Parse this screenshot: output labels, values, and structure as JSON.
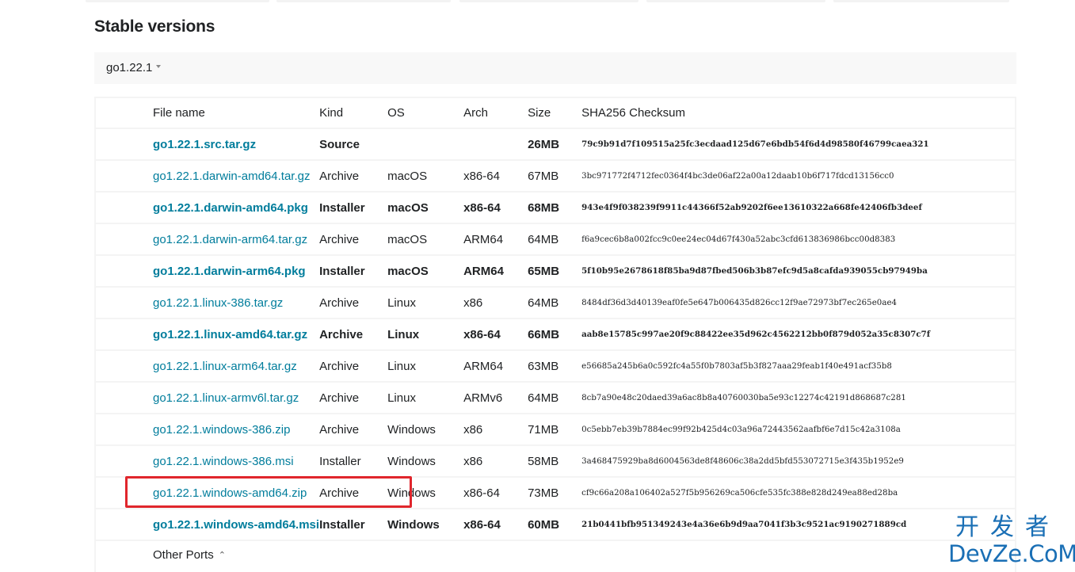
{
  "section": {
    "title": "Stable versions",
    "version_selected": "go1.22.1"
  },
  "table": {
    "headers": [
      "File name",
      "Kind",
      "OS",
      "Arch",
      "Size",
      "SHA256 Checksum"
    ],
    "rows": [
      {
        "name": "go1.22.1.src.tar.gz",
        "kind": "Source",
        "os": "",
        "arch": "",
        "size": "26MB",
        "sha256": "79c9b91d7f109515a25fc3ecdaad125d67e6bdb54f6d4d98580f46799caea321",
        "featured": true
      },
      {
        "name": "go1.22.1.darwin-amd64.tar.gz",
        "kind": "Archive",
        "os": "macOS",
        "arch": "x86-64",
        "size": "67MB",
        "sha256": "3bc971772f4712fec0364f4bc3de06af22a00a12daab10b6f717fdcd13156cc0",
        "featured": false
      },
      {
        "name": "go1.22.1.darwin-amd64.pkg",
        "kind": "Installer",
        "os": "macOS",
        "arch": "x86-64",
        "size": "68MB",
        "sha256": "943e4f9f038239f9911c44366f52ab9202f6ee13610322a668fe42406fb3deef",
        "featured": true
      },
      {
        "name": "go1.22.1.darwin-arm64.tar.gz",
        "kind": "Archive",
        "os": "macOS",
        "arch": "ARM64",
        "size": "64MB",
        "sha256": "f6a9cec6b8a002fcc9c0ee24ec04d67f430a52abc3cfd613836986bcc00d8383",
        "featured": false
      },
      {
        "name": "go1.22.1.darwin-arm64.pkg",
        "kind": "Installer",
        "os": "macOS",
        "arch": "ARM64",
        "size": "65MB",
        "sha256": "5f10b95e2678618f85ba9d87fbed506b3b87efc9d5a8cafda939055cb97949ba",
        "featured": true
      },
      {
        "name": "go1.22.1.linux-386.tar.gz",
        "kind": "Archive",
        "os": "Linux",
        "arch": "x86",
        "size": "64MB",
        "sha256": "8484df36d3d40139eaf0fe5e647b006435d826cc12f9ae72973bf7ec265e0ae4",
        "featured": false
      },
      {
        "name": "go1.22.1.linux-amd64.tar.gz",
        "kind": "Archive",
        "os": "Linux",
        "arch": "x86-64",
        "size": "66MB",
        "sha256": "aab8e15785c997ae20f9c88422ee35d962c4562212bb0f879d052a35c8307c7f",
        "featured": true
      },
      {
        "name": "go1.22.1.linux-arm64.tar.gz",
        "kind": "Archive",
        "os": "Linux",
        "arch": "ARM64",
        "size": "63MB",
        "sha256": "e56685a245b6a0c592fc4a55f0b7803af5b3f827aaa29feab1f40e491acf35b8",
        "featured": false
      },
      {
        "name": "go1.22.1.linux-armv6l.tar.gz",
        "kind": "Archive",
        "os": "Linux",
        "arch": "ARMv6",
        "size": "64MB",
        "sha256": "8cb7a90e48c20daed39a6ac8b8a40760030ba5e93c12274c42191d868687c281",
        "featured": false
      },
      {
        "name": "go1.22.1.windows-386.zip",
        "kind": "Archive",
        "os": "Windows",
        "arch": "x86",
        "size": "71MB",
        "sha256": "0c5ebb7eb39b7884ec99f92b425d4c03a96a72443562aafbf6e7d15c42a3108a",
        "featured": false
      },
      {
        "name": "go1.22.1.windows-386.msi",
        "kind": "Installer",
        "os": "Windows",
        "arch": "x86",
        "size": "58MB",
        "sha256": "3a468475929ba8d6004563de8f48606c38a2dd5bfd553072715e3f435b1952e9",
        "featured": false
      },
      {
        "name": "go1.22.1.windows-amd64.zip",
        "kind": "Archive",
        "os": "Windows",
        "arch": "x86-64",
        "size": "73MB",
        "sha256": "cf9c66a208a106402a527f5b956269ca506cfe535fc388e828d249ea88ed28ba",
        "featured": false
      },
      {
        "name": "go1.22.1.windows-amd64.msi",
        "kind": "Installer",
        "os": "Windows",
        "arch": "x86-64",
        "size": "60MB",
        "sha256": "21b0441bfb951349243e4a36e6b9d9aa7041f3b3c9521ac9190271889cd",
        "featured": true
      }
    ],
    "other_ports_label": "Other Ports",
    "other_ports_icon": "chevron-up-icon"
  },
  "annotation": {
    "highlighted_file": "go1.22.1.windows-amd64.zip",
    "color": "#e0262c"
  },
  "watermark": {
    "line1": "开发者",
    "line2": "DevZe.CoM"
  },
  "colors": {
    "link": "#007d9c",
    "text": "#202224",
    "version_bar_bg": "#f8f8f8"
  }
}
